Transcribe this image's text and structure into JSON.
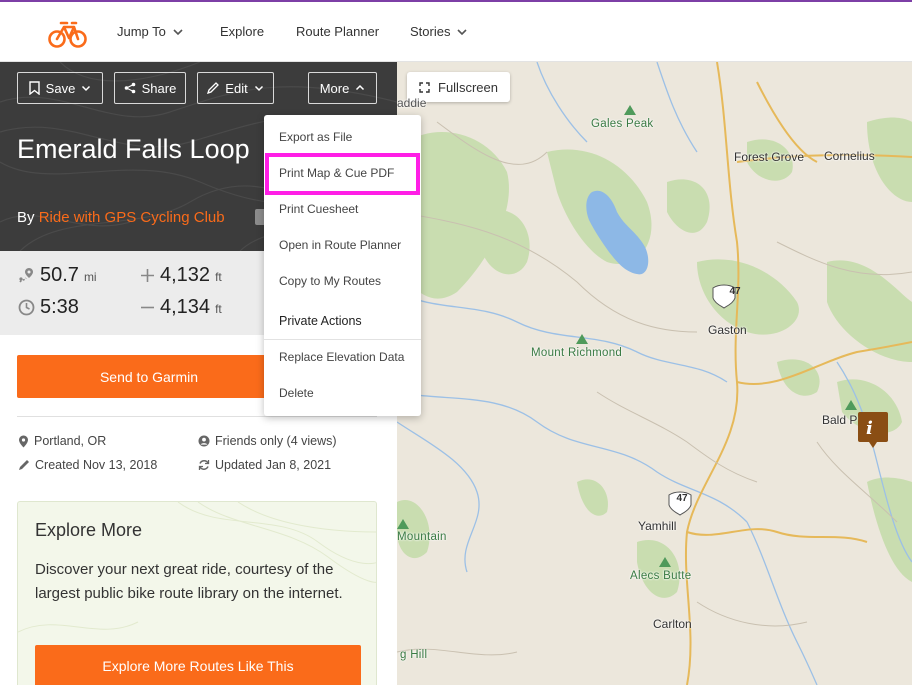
{
  "nav": {
    "items": [
      {
        "label": "Jump To",
        "has_chevron": true
      },
      {
        "label": "Explore",
        "has_chevron": false
      },
      {
        "label": "Route Planner",
        "has_chevron": false
      },
      {
        "label": "Stories",
        "has_chevron": true
      }
    ]
  },
  "toolbar": {
    "save_label": "Save",
    "share_label": "Share",
    "edit_label": "Edit",
    "more_label": "More"
  },
  "route": {
    "title": "Emerald Falls Loop",
    "by_prefix": "By",
    "organizer": "Ride with GPS Cycling Club"
  },
  "stats": {
    "distance": "50.7",
    "distance_unit": "mi",
    "duration": "5:38",
    "elevation_gain": "4,132",
    "elevation_gain_unit": "ft",
    "elevation_loss": "4,134",
    "elevation_loss_unit": "ft"
  },
  "actions": {
    "send_garmin": "Send to Garmin"
  },
  "meta": {
    "location": "Portland, OR",
    "privacy": "Friends only (4 views)",
    "created": "Created Nov 13, 2018",
    "updated": "Updated Jan 8, 2021"
  },
  "explore": {
    "title": "Explore More",
    "text": "Discover your next great ride, courtesy of the largest public bike route library on the internet.",
    "button": "Explore More Routes Like This"
  },
  "map": {
    "fullscreen_label": "Fullscreen",
    "places": {
      "forest_grove": "Forest Grove",
      "cornelius": "Cornelius",
      "gaston": "Gaston",
      "yamhill": "Yamhill",
      "carlton": "Carlton",
      "bald": "Bald P",
      "addie": "addie",
      "mountain": "Mountain",
      "g_hill": "g Hill"
    },
    "peaks": {
      "gales_peak": "Gales Peak",
      "mount_richmond": "Mount Richmond",
      "alecs_butte": "Alecs Butte"
    },
    "highway_47": "47"
  },
  "more_menu": {
    "export": "Export as File",
    "print_map": "Print Map & Cue PDF",
    "print_cuesheet": "Print Cuesheet",
    "open_planner": "Open in Route Planner",
    "copy": "Copy to My Routes",
    "private_header": "Private Actions",
    "replace_elevation": "Replace Elevation Data",
    "delete": "Delete"
  },
  "colors": {
    "accent": "#fa6b1a",
    "highlight": "#ff1ee6",
    "hero_bg": "#3c3c3c"
  }
}
